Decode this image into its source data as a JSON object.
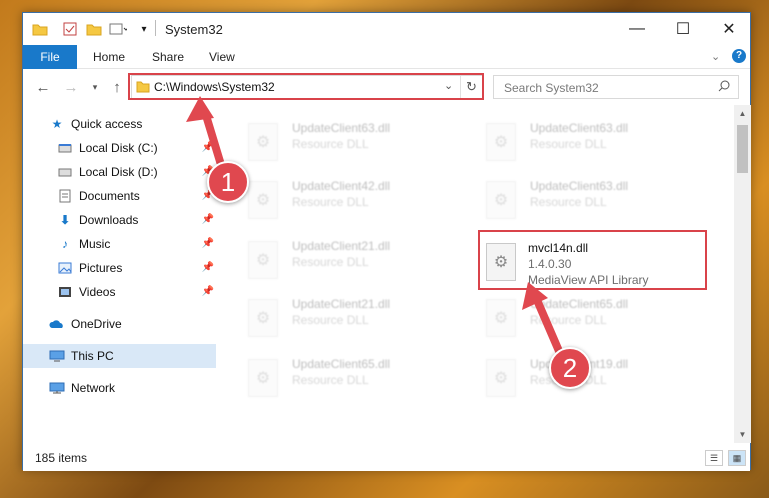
{
  "window": {
    "title": "System32"
  },
  "ribbon": {
    "tabs": [
      "File",
      "Home",
      "Share",
      "View"
    ]
  },
  "address": {
    "path": "C:\\Windows\\System32"
  },
  "search": {
    "placeholder": "Search System32"
  },
  "sidebar": {
    "items": [
      {
        "label": "Quick access",
        "icon": "star-icon"
      },
      {
        "label": "Local Disk (C:)",
        "icon": "drive-icon"
      },
      {
        "label": "Local Disk (D:)",
        "icon": "drive-icon"
      },
      {
        "label": "Documents",
        "icon": "documents-icon"
      },
      {
        "label": "Downloads",
        "icon": "download-icon"
      },
      {
        "label": "Music",
        "icon": "music-icon"
      },
      {
        "label": "Pictures",
        "icon": "pictures-icon"
      },
      {
        "label": "Videos",
        "icon": "videos-icon"
      },
      {
        "label": "OneDrive",
        "icon": "cloud-icon"
      },
      {
        "label": "This PC",
        "icon": "computer-icon"
      },
      {
        "label": "Network",
        "icon": "network-icon"
      }
    ]
  },
  "files": {
    "left": [
      {
        "name": "UpdateClient63.dll",
        "desc": "Resource DLL"
      },
      {
        "name": "UpdateClient42.dll",
        "desc": "Resource DLL"
      },
      {
        "name": "UpdateClient21.dll",
        "desc": "Resource DLL"
      },
      {
        "name": "UpdateClient21.dll",
        "desc": "Resource DLL"
      },
      {
        "name": "UpdateClient65.dll",
        "desc": "Resource DLL"
      }
    ],
    "right": [
      {
        "name": "UpdateClient63.dll",
        "desc": "Resource DLL"
      },
      {
        "name": "UpdateClient63.dll",
        "desc": "Resource DLL"
      },
      {
        "name": "UpdateClient65.dll",
        "desc": "Resource DLL"
      },
      {
        "name": "UpdateClient19.dll",
        "desc": "Resource DLL"
      }
    ],
    "target": {
      "name": "mvcl14n.dll",
      "version": "1.4.0.30",
      "desc": "MediaView API Library"
    }
  },
  "status": {
    "count": "185 items"
  },
  "callouts": [
    "1",
    "2"
  ],
  "colors": {
    "accent": "#1979ca",
    "highlight": "#d9434a",
    "callout": "#e0484f"
  }
}
